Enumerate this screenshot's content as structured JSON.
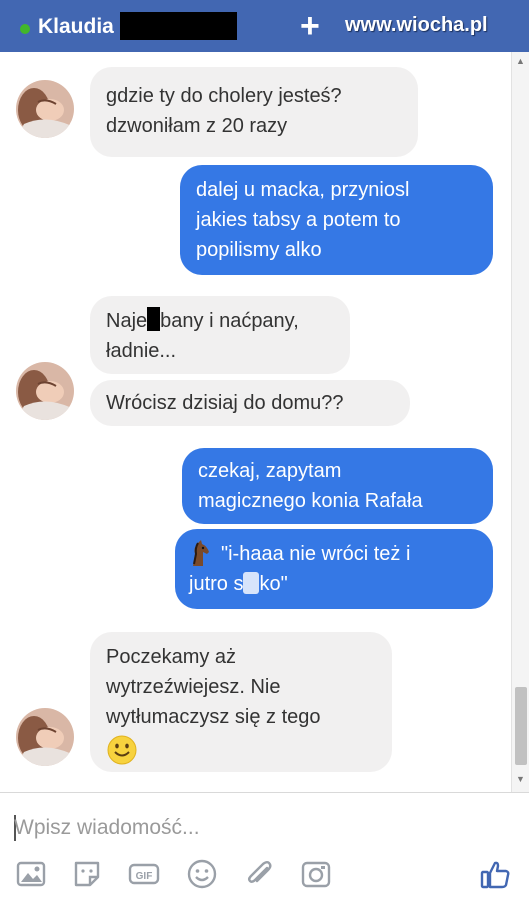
{
  "header": {
    "contact_name": "Klaudia",
    "add_icon": "+",
    "watermark": "www.wiocha.pl",
    "color": "#4267b2"
  },
  "messages": [
    {
      "direction": "in",
      "lines": [
        "gdzie ty do cholery jesteś?",
        "dzwoniłam z 20 razy"
      ]
    },
    {
      "direction": "out",
      "lines": [
        "dalej u macka, przyniosl",
        "jakies tabsy a potem to",
        "popilismy alko"
      ]
    },
    {
      "direction": "in",
      "line1_a": "Naje",
      "line1_b": "bany i naćpany,",
      "line2": "ładnie..."
    },
    {
      "direction": "in",
      "lines": [
        "Wrócisz dzisiaj do domu??"
      ]
    },
    {
      "direction": "out",
      "lines": [
        "czekaj, zapytam",
        "magicznego konia Rafała"
      ]
    },
    {
      "direction": "out",
      "icon": "horse-icon",
      "line1": "\"i-haaa nie wróci też i",
      "line2_a": "jutro s",
      "line2_b": "ko\""
    },
    {
      "direction": "in",
      "lines": [
        "Poczekamy aż",
        "wytrzeźwiejesz. Nie",
        "wytłumaczysz się z tego"
      ],
      "icon": "smile-emoji"
    }
  ],
  "composer": {
    "placeholder": "Wpisz wiadomość...",
    "tools": [
      "photo-icon",
      "sticker-icon",
      "gif-icon",
      "emoji-icon",
      "attachment-icon",
      "camera-icon",
      "thumbs-up-icon"
    ],
    "gif_label": "GIF"
  },
  "colors": {
    "outgoing": "#3578e5",
    "incoming": "#f1f0f0",
    "online": "#42b72a"
  }
}
